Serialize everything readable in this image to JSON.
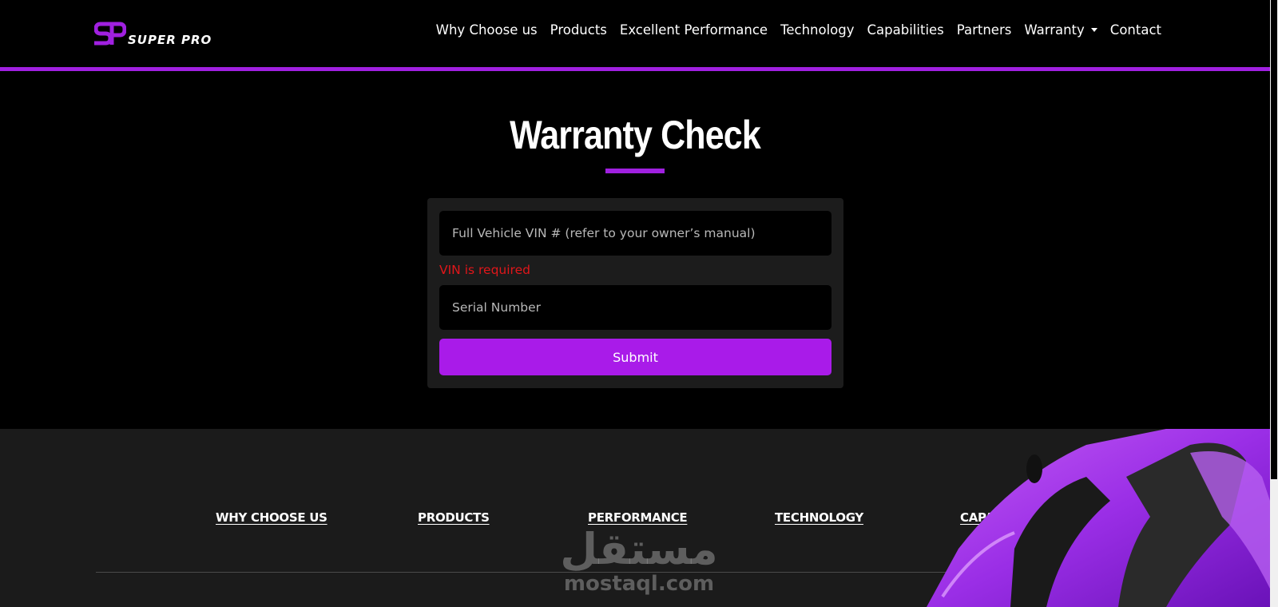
{
  "header": {
    "logo_text": "SUPER PRO",
    "nav": [
      {
        "label": "Why Choose us"
      },
      {
        "label": "Products"
      },
      {
        "label": "Excellent Performance"
      },
      {
        "label": "Technology"
      },
      {
        "label": "Capabilities"
      },
      {
        "label": "Partners"
      },
      {
        "label": "Warranty"
      },
      {
        "label": "Contact"
      }
    ]
  },
  "main": {
    "title": "Warranty Check",
    "form": {
      "vin_placeholder": "Full Vehicle VIN # (refer to your owner’s manual)",
      "vin_value": "",
      "vin_error": "VIN is required",
      "serial_placeholder": "Serial Number",
      "serial_value": "",
      "submit_label": "Submit"
    }
  },
  "footer": {
    "links": [
      {
        "label": "WHY CHOOSE US"
      },
      {
        "label": "PRODUCTS"
      },
      {
        "label": "PERFORMANCE"
      },
      {
        "label": "TECHNOLOGY"
      },
      {
        "label": "CAPAB"
      }
    ]
  },
  "watermark": {
    "arabic": "مستقل",
    "latin": "mostaql.com"
  },
  "colors": {
    "accent": "#a020e0",
    "button": "#a91be9",
    "error": "#e0161a",
    "card": "#1c1c1c",
    "footer": "#1b1b1b"
  },
  "icons": [
    "super-pro-logo-icon",
    "dropdown-caret-icon",
    "car-image"
  ]
}
